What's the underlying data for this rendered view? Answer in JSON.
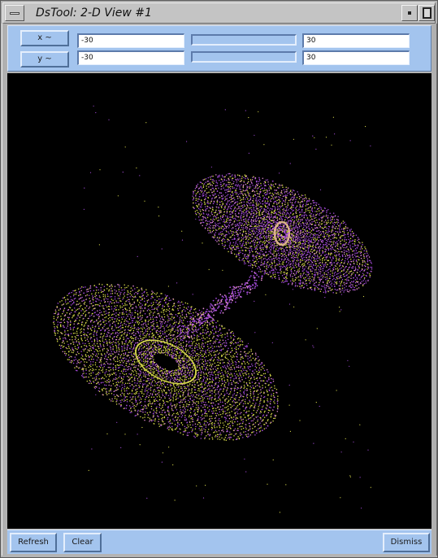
{
  "window": {
    "title": "DsTool: 2-D View #1"
  },
  "controls": {
    "x_button_label": "x ~",
    "y_button_label": "y ~",
    "x_min": "-30",
    "x_max": "30",
    "y_min": "-30",
    "y_max": "30"
  },
  "footer": {
    "refresh_label": "Refresh",
    "clear_label": "Clear",
    "dismiss_label": "Dismiss"
  },
  "plot": {
    "colors": {
      "trajectory_yellow": "#d6d84a",
      "trajectory_purple": "#a24ad8",
      "trajectory_pink": "#e08ad0",
      "background": "#000000"
    }
  }
}
